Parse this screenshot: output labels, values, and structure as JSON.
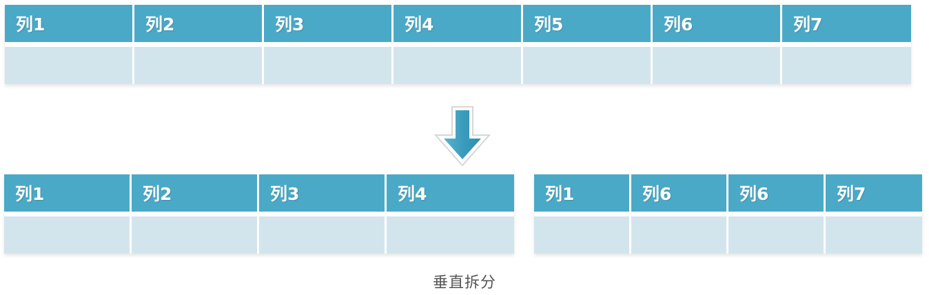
{
  "top_table": {
    "headers": [
      "列1",
      "列2",
      "列3",
      "列4",
      "列5",
      "列6",
      "列7"
    ]
  },
  "bottom_left_table": {
    "headers": [
      "列1",
      "列2",
      "列3",
      "列4"
    ]
  },
  "bottom_right_table": {
    "headers": [
      "列1",
      "列6",
      "列6",
      "列7"
    ]
  },
  "caption": "垂直拆分",
  "colors": {
    "header_bg": "#4aa9c6",
    "cell_bg": "#d3e5ec",
    "arrow": "#3f9fbe",
    "caption_text": "#555555"
  },
  "icons": {
    "arrow": "down-arrow-icon"
  }
}
